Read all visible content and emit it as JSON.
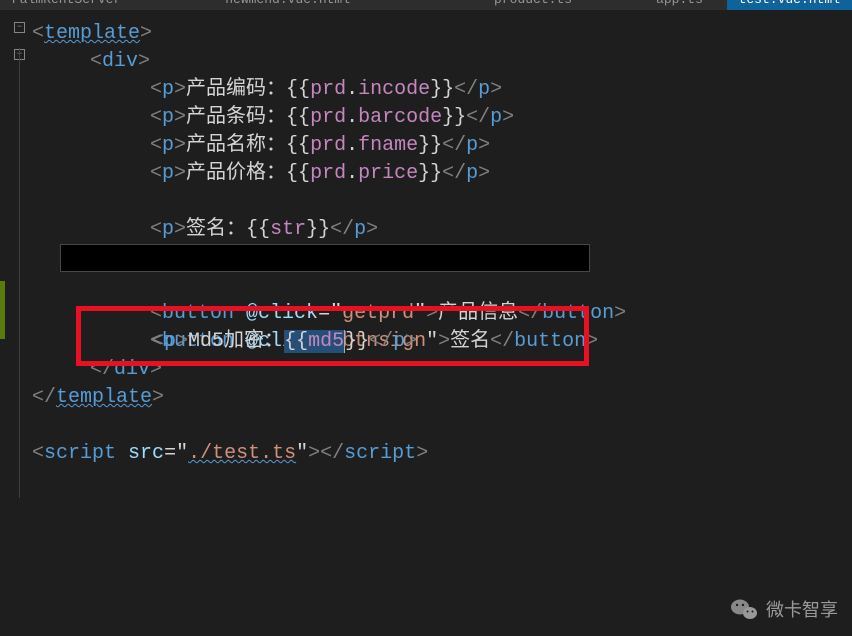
{
  "tabs": [
    {
      "label": "PalmRentServer",
      "active": false
    },
    {
      "label": "newmend.vue.html",
      "active": false
    },
    {
      "label": "product.ts",
      "active": false
    },
    {
      "label": "app.ts",
      "active": false
    },
    {
      "label": "test.vue.html",
      "active": true
    }
  ],
  "code": {
    "template_open": "template",
    "div_open": "div",
    "p_tag": "p",
    "button_tag": "button",
    "script_tag": "script",
    "div_close": "div",
    "template_close": "template",
    "click_attr": "@click",
    "src_attr": "src",
    "getprd_val": "getprd",
    "btnsign_val": "btnsign",
    "test_ts_val": "./test.ts",
    "line1_text": "产品编码：",
    "line1_expr_obj": "prd",
    "line1_expr_prop": "incode",
    "line2_text": "产品条码：",
    "line2_expr_obj": "prd",
    "line2_expr_prop": "barcode",
    "line3_text": "产品名称：",
    "line3_expr_obj": "prd",
    "line3_expr_prop": "fname",
    "line4_text": "产品价格：",
    "line4_expr_obj": "prd",
    "line4_expr_prop": "price",
    "line5_text": "签名：",
    "line5_expr": "str",
    "line6_text": "Md5加密：",
    "line6_expr": "md5",
    "btn1_text": "产品信息",
    "btn2_text": "签名"
  },
  "watermark": "微卡智享"
}
